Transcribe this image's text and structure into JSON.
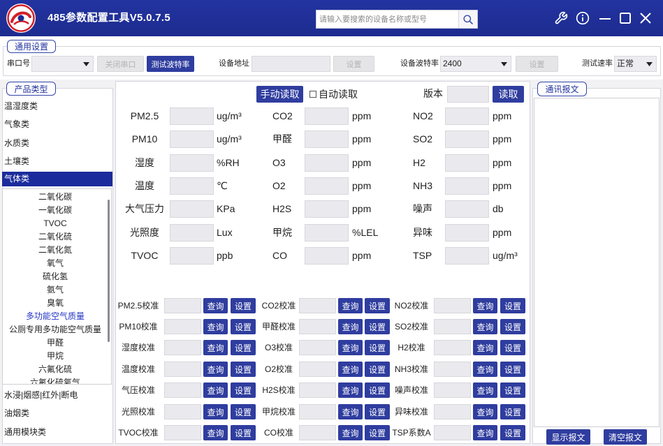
{
  "app": {
    "title": "485参数配置工具V5.0.7.5"
  },
  "search": {
    "placeholder": "请输入要搜索的设备名称或型号",
    "value": ""
  },
  "icons": {
    "logo": "app-logo",
    "search": "search-icon",
    "settings": "wrench-icon",
    "about": "info-icon",
    "minimize": "minimize-icon",
    "maximize": "maximize-icon",
    "close": "close-icon",
    "dropdown": "chevron-down-icon",
    "auto_read": "checkbox"
  },
  "colors": {
    "title_bar": "#1d2c8f",
    "primary_button": "#2f3d9f",
    "selected_item": "#1b2b9c",
    "selected_device_text": "#2235c4",
    "tab_border": "#3445a8"
  },
  "general_settings": {
    "title": "通用设置",
    "serial_port_label": "串口号",
    "serial_port_value": "",
    "close_port_button": "关闭串口",
    "close_port_enabled": false,
    "test_baud_button": "测试波特率",
    "device_address_label": "设备地址",
    "device_address_value": "",
    "set_address_button": "设置",
    "set_address_enabled": false,
    "device_baud_label": "设备波特率",
    "device_baud_value": "2400",
    "set_baud_button": "设置",
    "set_baud_enabled": false,
    "test_rate_label": "测试速率",
    "test_rate_value": "正常"
  },
  "product_types": {
    "title": "产品类型",
    "categories_top": [
      {
        "label": "温湿度类",
        "selected": false
      },
      {
        "label": "气象类",
        "selected": false
      },
      {
        "label": "水质类",
        "selected": false
      },
      {
        "label": "土壤类",
        "selected": false
      },
      {
        "label": "气体类",
        "selected": true
      }
    ],
    "gas_devices": [
      {
        "label": "二氧化碳",
        "selected": false
      },
      {
        "label": "一氧化碳",
        "selected": false
      },
      {
        "label": "TVOC",
        "selected": false
      },
      {
        "label": "二氧化硫",
        "selected": false
      },
      {
        "label": "二氧化氮",
        "selected": false
      },
      {
        "label": "氧气",
        "selected": false
      },
      {
        "label": "硫化氢",
        "selected": false
      },
      {
        "label": "氨气",
        "selected": false
      },
      {
        "label": "臭氧",
        "selected": false
      },
      {
        "label": "多功能空气质量",
        "selected": true
      },
      {
        "label": "公厕专用多功能空气质量",
        "selected": false
      },
      {
        "label": "甲醛",
        "selected": false
      },
      {
        "label": "甲烷",
        "selected": false
      },
      {
        "label": "六氟化硫",
        "selected": false
      },
      {
        "label": "六氟化硫氧气",
        "selected": false
      }
    ],
    "categories_bottom": [
      {
        "label": "水浸|烟感|红外|断电",
        "selected": false
      },
      {
        "label": "油烟类",
        "selected": false
      },
      {
        "label": "通用模块类",
        "selected": false
      }
    ]
  },
  "readings": {
    "manual_read_button": "手动读取",
    "auto_read_label": "自动读取",
    "auto_read_checked": false,
    "version_label": "版本",
    "version_value": "",
    "read_button": "读取",
    "columns": [
      [
        {
          "label": "PM2.5",
          "value": "",
          "unit": "ug/m³"
        },
        {
          "label": "PM10",
          "value": "",
          "unit": "ug/m³"
        },
        {
          "label": "湿度",
          "value": "",
          "unit": "%RH"
        },
        {
          "label": "温度",
          "value": "",
          "unit": "℃"
        },
        {
          "label": "大气压力",
          "value": "",
          "unit": "KPa"
        },
        {
          "label": "光照度",
          "value": "",
          "unit": "Lux"
        },
        {
          "label": "TVOC",
          "value": "",
          "unit": "ppb"
        }
      ],
      [
        {
          "label": "CO2",
          "value": "",
          "unit": "ppm"
        },
        {
          "label": "甲醛",
          "value": "",
          "unit": "ppm"
        },
        {
          "label": "O3",
          "value": "",
          "unit": "ppm"
        },
        {
          "label": "O2",
          "value": "",
          "unit": "ppm"
        },
        {
          "label": "H2S",
          "value": "",
          "unit": "ppm"
        },
        {
          "label": "甲烷",
          "value": "",
          "unit": "%LEL"
        },
        {
          "label": "CO",
          "value": "",
          "unit": "ppm"
        }
      ],
      [
        {
          "label": "NO2",
          "value": "",
          "unit": "ppm"
        },
        {
          "label": "SO2",
          "value": "",
          "unit": "ppm"
        },
        {
          "label": "H2",
          "value": "",
          "unit": "ppm"
        },
        {
          "label": "NH3",
          "value": "",
          "unit": "ppm"
        },
        {
          "label": "噪声",
          "value": "",
          "unit": "db"
        },
        {
          "label": "异味",
          "value": "",
          "unit": "ppm"
        },
        {
          "label": "TSP",
          "value": "",
          "unit": "ug/m³"
        }
      ]
    ]
  },
  "calibration": {
    "query_label": "查询",
    "set_label": "设置",
    "columns": [
      [
        {
          "label": "PM2.5校准",
          "value": ""
        },
        {
          "label": "PM10校准",
          "value": ""
        },
        {
          "label": "湿度校准",
          "value": ""
        },
        {
          "label": "温度校准",
          "value": ""
        },
        {
          "label": "气压校准",
          "value": ""
        },
        {
          "label": "光照校准",
          "value": ""
        },
        {
          "label": "TVOC校准",
          "value": ""
        }
      ],
      [
        {
          "label": "CO2校准",
          "value": ""
        },
        {
          "label": "甲醛校准",
          "value": ""
        },
        {
          "label": "O3校准",
          "value": ""
        },
        {
          "label": "O2校准",
          "value": ""
        },
        {
          "label": "H2S校准",
          "value": ""
        },
        {
          "label": "甲烷校准",
          "value": ""
        },
        {
          "label": "CO校准",
          "value": ""
        }
      ],
      [
        {
          "label": "NO2校准",
          "value": ""
        },
        {
          "label": "SO2校准",
          "value": ""
        },
        {
          "label": "H2校准",
          "value": ""
        },
        {
          "label": "NH3校准",
          "value": ""
        },
        {
          "label": "噪声校准",
          "value": ""
        },
        {
          "label": "异味校准",
          "value": ""
        },
        {
          "label": "TSP系数A",
          "value": ""
        }
      ]
    ]
  },
  "messages": {
    "title": "通讯报文",
    "log": "",
    "show_button": "显示报文",
    "clear_button": "清空报文"
  }
}
